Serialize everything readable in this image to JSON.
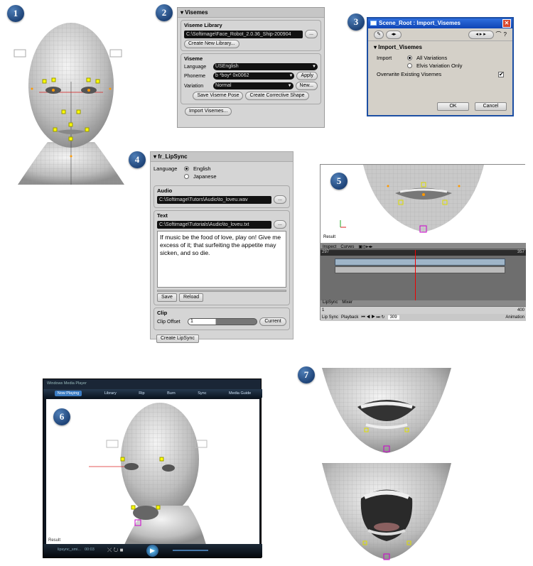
{
  "badges": {
    "b1": "1",
    "b2": "2",
    "b3": "3",
    "b4": "4",
    "b5": "5",
    "b6": "6",
    "b7": "7"
  },
  "visemes": {
    "title": "Visemes",
    "library_label": "Viseme Library",
    "library_path": "C:\\Softimage\\Face_Robot_2.0.36_Ship-200904",
    "browse": "...",
    "create_library": "Create New Library...",
    "viseme_label": "Viseme",
    "language_label": "Language",
    "language_value": "USEnglish",
    "phoneme_label": "Phoneme",
    "phoneme_value": "b *boy* 0x0062",
    "apply": "Apply",
    "variation_label": "Variation",
    "variation_value": "Normal",
    "new": "New...",
    "save_pose": "Save Viseme Pose",
    "corrective": "Create Corrective Shape",
    "import": "Import Visemes..."
  },
  "import_dialog": {
    "title": "Scene_Root : Import_Visemes",
    "close": "✕",
    "section": "Import_Visemes",
    "import_label": "Import",
    "opt1": "All Variations",
    "opt2": "Elvis Variation Only",
    "overwrite": "Overwrite Existing Visemes",
    "ok": "OK",
    "cancel": "Cancel"
  },
  "lipsync": {
    "title": "fr_LipSync",
    "language_label": "Language",
    "english": "English",
    "japanese": "Japanese",
    "audio_label": "Audio",
    "audio_path": "C:\\Softimage\\Tutors\\Audio\\to_loveu.wav",
    "text_label": "Text",
    "text_path": "C:\\Softimage\\Tutorials\\Audio\\to_loveu.txt",
    "text_body": "If music be the food of love, play on! Give me excess of it; that surfeiting the appetite may sicken, and so die.",
    "save": "Save",
    "reload": "Reload",
    "clip_label": "Clip",
    "clip_offset_label": "Clip Offset",
    "clip_offset": "1",
    "current": "Current",
    "create": "Create LipSync",
    "browse": "..."
  },
  "viewport5": {
    "result": "Result",
    "tab_inspect": "Inspect",
    "tab_curves": "Curves",
    "start": "297",
    "end": "357",
    "lipsync_tab": "LipSync",
    "mixer_tab": "Mixer",
    "frame": "1",
    "end_frame": "400",
    "lipsync_label": "Lip Sync",
    "playback": "Playback",
    "animation": "Animation",
    "current_frame": "309"
  },
  "wmp": {
    "title": "Windows Media Player",
    "tabs": [
      "Now Playing",
      "Library",
      "Rip",
      "Burn",
      "Sync",
      "Media Guide"
    ],
    "result": "Result",
    "file": "lipsync_smi...",
    "time": "00:03"
  }
}
